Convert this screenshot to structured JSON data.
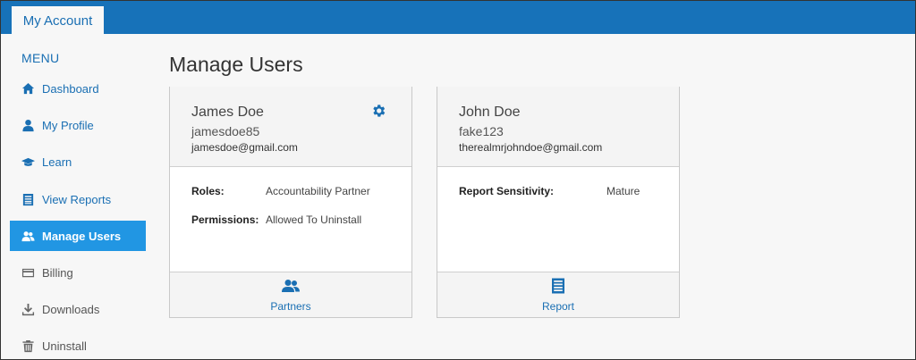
{
  "app": {
    "tab_label": "My Account"
  },
  "sidebar": {
    "heading": "MENU",
    "items": [
      {
        "label": "Dashboard",
        "icon": "home-icon"
      },
      {
        "label": "My Profile",
        "icon": "user-icon"
      },
      {
        "label": "Learn",
        "icon": "graduation-cap-icon"
      },
      {
        "label": "View Reports",
        "icon": "report-icon"
      },
      {
        "label": "Manage Users",
        "icon": "users-icon"
      },
      {
        "label": "Billing",
        "icon": "credit-card-icon"
      },
      {
        "label": "Downloads",
        "icon": "download-icon"
      },
      {
        "label": "Uninstall",
        "icon": "trash-icon"
      }
    ],
    "active_item": "Manage Users"
  },
  "main": {
    "title": "Manage Users",
    "cards": [
      {
        "name": "James Doe",
        "username": "jamesdoe85",
        "email": "jamesdoe@gmail.com",
        "fields": [
          {
            "key": "Roles:",
            "value": "Accountability Partner"
          },
          {
            "key": "Permissions:",
            "value": "Allowed To Uninstall"
          }
        ],
        "footer_label": "Partners",
        "footer_icon": "partners-icon"
      },
      {
        "name": "John Doe",
        "username": "fake123",
        "email": "therealmrjohndoe@gmail.com",
        "fields": [
          {
            "key": "Report Sensitivity:",
            "value": "Mature"
          }
        ],
        "footer_label": "Report",
        "footer_icon": "report-icon"
      }
    ]
  },
  "colors": {
    "brand": "#1772b9",
    "active": "#2196e3",
    "link": "#1a6fb3"
  }
}
